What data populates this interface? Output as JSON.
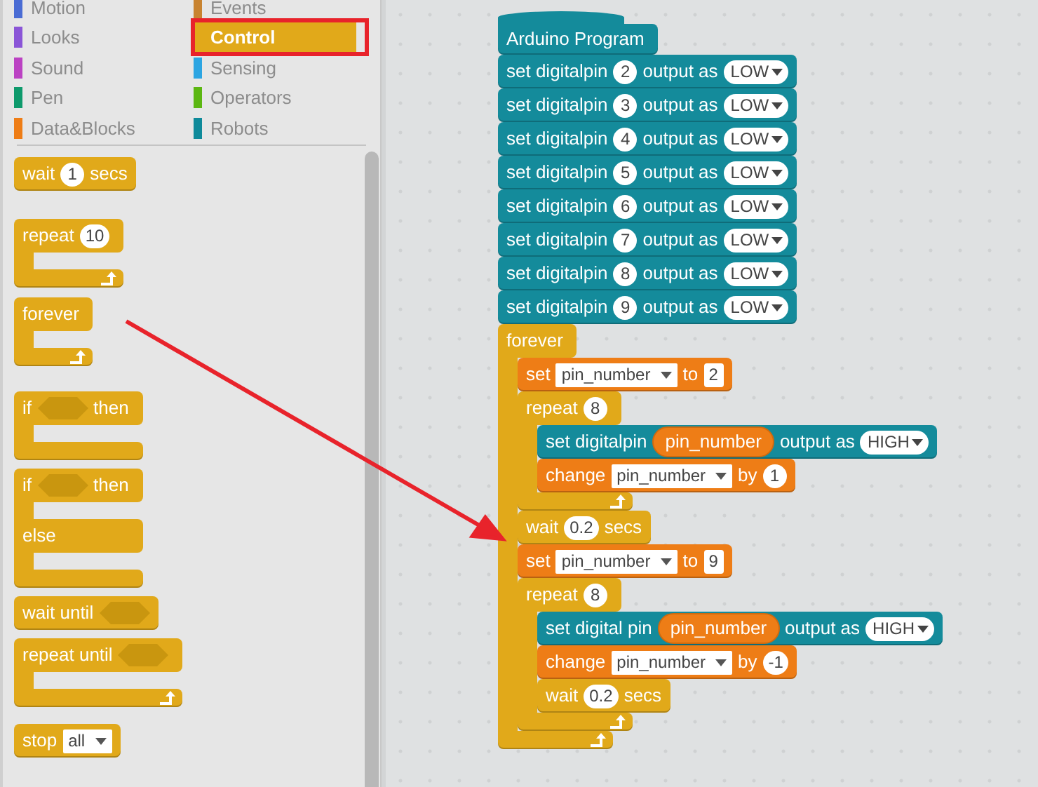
{
  "categories": [
    {
      "label": "Motion",
      "color": "#4a6cd4",
      "selected": false
    },
    {
      "label": "Looks",
      "color": "#8a55d7",
      "selected": false
    },
    {
      "label": "Sound",
      "color": "#bb42c3",
      "selected": false
    },
    {
      "label": "Pen",
      "color": "#0e9a6c",
      "selected": false
    },
    {
      "label": "Data&Blocks",
      "color": "#ee7d16",
      "selected": false
    },
    {
      "label": "Events",
      "color": "#c88330",
      "selected": false
    },
    {
      "label": "Control",
      "color": "#e1a91a",
      "selected": true
    },
    {
      "label": "Sensing",
      "color": "#2ca5e2",
      "selected": false
    },
    {
      "label": "Operators",
      "color": "#5cb712",
      "selected": false
    },
    {
      "label": "Robots",
      "color": "#0e8a9a",
      "selected": false
    }
  ],
  "palette_blocks": [
    {
      "kind": "stack",
      "color": "#e1a91a",
      "parts": [
        {
          "kind": "text",
          "text": "wait"
        },
        {
          "kind": "number",
          "text": "1"
        },
        {
          "kind": "text",
          "text": "secs"
        }
      ]
    },
    {
      "kind": "c",
      "color": "#e1a91a",
      "parts": [
        {
          "kind": "text",
          "text": "repeat"
        },
        {
          "kind": "number",
          "text": "10"
        }
      ]
    },
    {
      "kind": "c",
      "color": "#e1a91a",
      "parts": [
        {
          "kind": "text",
          "text": "forever"
        }
      ]
    },
    {
      "kind": "if",
      "color": "#e1a91a",
      "parts": [
        {
          "kind": "text",
          "text": "if"
        },
        {
          "kind": "slot"
        },
        {
          "kind": "text",
          "text": "then"
        }
      ]
    },
    {
      "kind": "if_else",
      "color": "#e1a91a",
      "parts": [
        {
          "kind": "text",
          "text": "if"
        },
        {
          "kind": "slot"
        },
        {
          "kind": "text",
          "text": "then"
        }
      ],
      "else_parts": [
        {
          "kind": "text",
          "text": "else"
        }
      ]
    },
    {
      "kind": "stack",
      "color": "#e1a91a",
      "parts": [
        {
          "kind": "text",
          "text": "wait until"
        },
        {
          "kind": "slot"
        }
      ]
    },
    {
      "kind": "c",
      "color": "#e1a91a",
      "parts": [
        {
          "kind": "text",
          "text": "repeat until"
        },
        {
          "kind": "slot"
        }
      ]
    },
    {
      "kind": "stack",
      "color": "#e1a91a",
      "parts": [
        {
          "kind": "text",
          "text": "stop"
        },
        {
          "kind": "var_dropdown",
          "text": "all"
        }
      ]
    }
  ],
  "script": {
    "hat": {
      "color": "#148b9b",
      "parts": [
        {
          "kind": "text",
          "text": "Arduino Program"
        }
      ]
    },
    "blocks": [
      {
        "kind": "stack",
        "color": "#148b9b",
        "parts": [
          {
            "kind": "text",
            "text": "set digitalpin"
          },
          {
            "kind": "number",
            "text": "2"
          },
          {
            "kind": "text",
            "text": "output as"
          },
          {
            "kind": "dropdown",
            "text": "LOW"
          }
        ]
      },
      {
        "kind": "stack",
        "color": "#148b9b",
        "parts": [
          {
            "kind": "text",
            "text": "set digitalpin"
          },
          {
            "kind": "number",
            "text": "3"
          },
          {
            "kind": "text",
            "text": "output as"
          },
          {
            "kind": "dropdown",
            "text": "LOW"
          }
        ]
      },
      {
        "kind": "stack",
        "color": "#148b9b",
        "parts": [
          {
            "kind": "text",
            "text": "set digitalpin"
          },
          {
            "kind": "number",
            "text": "4"
          },
          {
            "kind": "text",
            "text": "output as"
          },
          {
            "kind": "dropdown",
            "text": "LOW"
          }
        ]
      },
      {
        "kind": "stack",
        "color": "#148b9b",
        "parts": [
          {
            "kind": "text",
            "text": "set digitalpin"
          },
          {
            "kind": "number",
            "text": "5"
          },
          {
            "kind": "text",
            "text": "output as"
          },
          {
            "kind": "dropdown",
            "text": "LOW"
          }
        ]
      },
      {
        "kind": "stack",
        "color": "#148b9b",
        "parts": [
          {
            "kind": "text",
            "text": "set digitalpin"
          },
          {
            "kind": "number",
            "text": "6"
          },
          {
            "kind": "text",
            "text": "output as"
          },
          {
            "kind": "dropdown",
            "text": "LOW"
          }
        ]
      },
      {
        "kind": "stack",
        "color": "#148b9b",
        "parts": [
          {
            "kind": "text",
            "text": "set digitalpin"
          },
          {
            "kind": "number",
            "text": "7"
          },
          {
            "kind": "text",
            "text": "output as"
          },
          {
            "kind": "dropdown",
            "text": "LOW"
          }
        ]
      },
      {
        "kind": "stack",
        "color": "#148b9b",
        "parts": [
          {
            "kind": "text",
            "text": "set digitalpin"
          },
          {
            "kind": "number",
            "text": "8"
          },
          {
            "kind": "text",
            "text": "output as"
          },
          {
            "kind": "dropdown",
            "text": "LOW"
          }
        ]
      },
      {
        "kind": "stack",
        "color": "#148b9b",
        "parts": [
          {
            "kind": "text",
            "text": "set digitalpin"
          },
          {
            "kind": "number",
            "text": "9"
          },
          {
            "kind": "text",
            "text": "output as"
          },
          {
            "kind": "dropdown",
            "text": "LOW"
          }
        ]
      },
      {
        "kind": "c",
        "color": "#e1a91a",
        "parts": [
          {
            "kind": "text",
            "text": "forever"
          }
        ],
        "children": [
          {
            "kind": "stack",
            "color": "#ee7d16",
            "parts": [
              {
                "kind": "text",
                "text": "set"
              },
              {
                "kind": "var_dropdown",
                "text": "pin_number"
              },
              {
                "kind": "text",
                "text": "to"
              },
              {
                "kind": "field",
                "text": "2"
              }
            ]
          },
          {
            "kind": "c",
            "color": "#e1a91a",
            "parts": [
              {
                "kind": "text",
                "text": "repeat"
              },
              {
                "kind": "number",
                "text": "8"
              }
            ],
            "children": [
              {
                "kind": "stack",
                "color": "#148b9b",
                "parts": [
                  {
                    "kind": "text",
                    "text": "set digitalpin"
                  },
                  {
                    "kind": "reporter",
                    "text": "pin_number"
                  },
                  {
                    "kind": "text",
                    "text": "output as"
                  },
                  {
                    "kind": "dropdown",
                    "text": "HIGH"
                  }
                ]
              },
              {
                "kind": "stack",
                "color": "#ee7d16",
                "parts": [
                  {
                    "kind": "text",
                    "text": "change"
                  },
                  {
                    "kind": "var_dropdown",
                    "text": "pin_number"
                  },
                  {
                    "kind": "text",
                    "text": "by"
                  },
                  {
                    "kind": "number",
                    "text": "1"
                  }
                ]
              }
            ]
          },
          {
            "kind": "stack",
            "color": "#e1a91a",
            "parts": [
              {
                "kind": "text",
                "text": "wait"
              },
              {
                "kind": "number",
                "text": "0.2"
              },
              {
                "kind": "text",
                "text": "secs"
              }
            ]
          },
          {
            "kind": "stack",
            "color": "#ee7d16",
            "parts": [
              {
                "kind": "text",
                "text": "set"
              },
              {
                "kind": "var_dropdown",
                "text": "pin_number"
              },
              {
                "kind": "text",
                "text": "to"
              },
              {
                "kind": "field",
                "text": "9"
              }
            ]
          },
          {
            "kind": "c",
            "color": "#e1a91a",
            "parts": [
              {
                "kind": "text",
                "text": "repeat"
              },
              {
                "kind": "number",
                "text": "8"
              }
            ],
            "children": [
              {
                "kind": "stack",
                "color": "#148b9b",
                "parts": [
                  {
                    "kind": "text",
                    "text": "set digital pin"
                  },
                  {
                    "kind": "reporter",
                    "text": "pin_number"
                  },
                  {
                    "kind": "text",
                    "text": "output as"
                  },
                  {
                    "kind": "dropdown",
                    "text": "HIGH"
                  }
                ]
              },
              {
                "kind": "stack",
                "color": "#ee7d16",
                "parts": [
                  {
                    "kind": "text",
                    "text": "change"
                  },
                  {
                    "kind": "var_dropdown",
                    "text": "pin_number"
                  },
                  {
                    "kind": "text",
                    "text": "by"
                  },
                  {
                    "kind": "number",
                    "text": "-1"
                  }
                ]
              },
              {
                "kind": "stack",
                "color": "#e1a91a",
                "parts": [
                  {
                    "kind": "text",
                    "text": "wait"
                  },
                  {
                    "kind": "number",
                    "text": "0.2"
                  },
                  {
                    "kind": "text",
                    "text": "secs"
                  }
                ]
              }
            ]
          }
        ]
      }
    ]
  }
}
